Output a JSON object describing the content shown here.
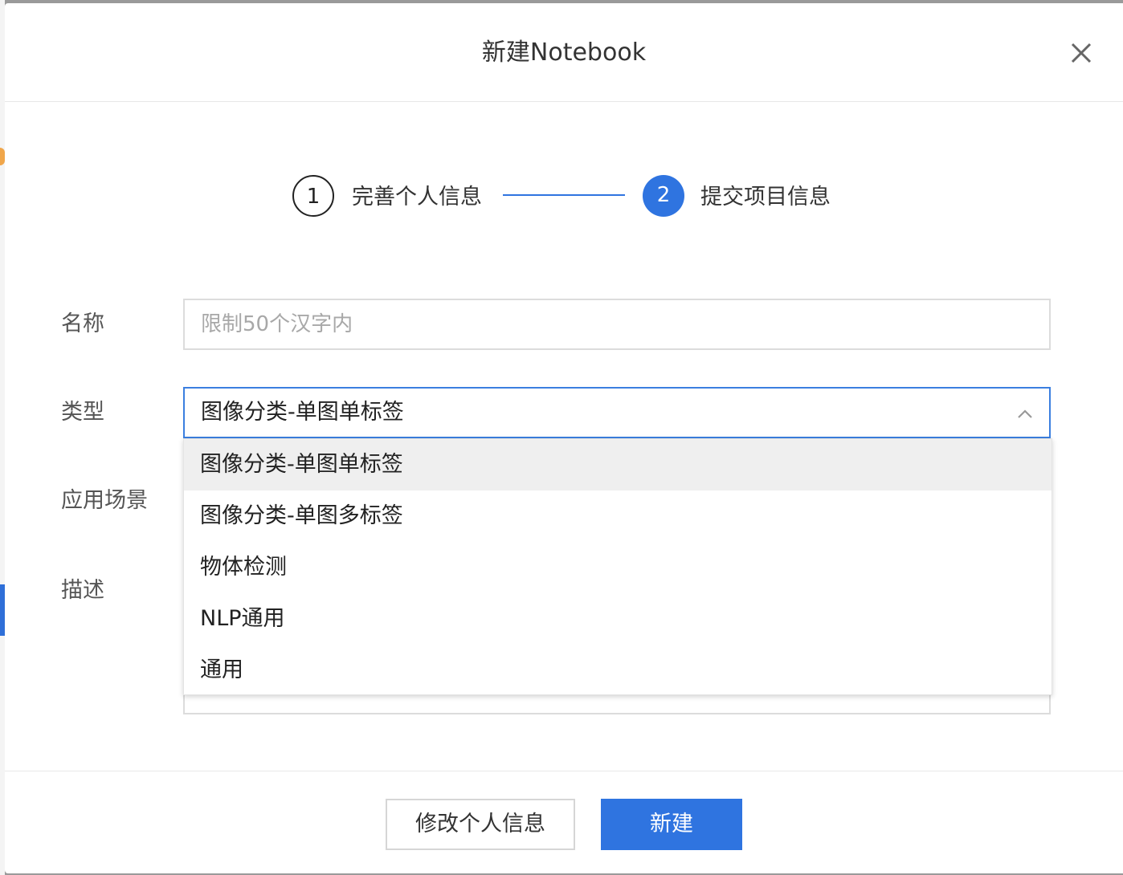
{
  "modal": {
    "title": "新建Notebook",
    "close_icon": "close-icon"
  },
  "steps": [
    {
      "number": "1",
      "label": "完善个人信息",
      "state": "done"
    },
    {
      "number": "2",
      "label": "提交项目信息",
      "state": "active"
    }
  ],
  "form": {
    "name": {
      "label": "名称",
      "placeholder": "限制50个汉字内",
      "value": ""
    },
    "type": {
      "label": "类型",
      "selected": "图像分类-单图单标签",
      "options": [
        "图像分类-单图单标签",
        "图像分类-单图多标签",
        "物体检测",
        "NLP通用",
        "通用"
      ],
      "highlighted_index": 0,
      "icon": "chevron-up-icon"
    },
    "scene": {
      "label": "应用场景"
    },
    "description": {
      "label": "描述"
    }
  },
  "footer": {
    "back_label": "修改个人信息",
    "submit_label": "新建"
  },
  "colors": {
    "accent": "#2f74e0",
    "border": "#dcdcdc",
    "highlight": "#efefef"
  }
}
